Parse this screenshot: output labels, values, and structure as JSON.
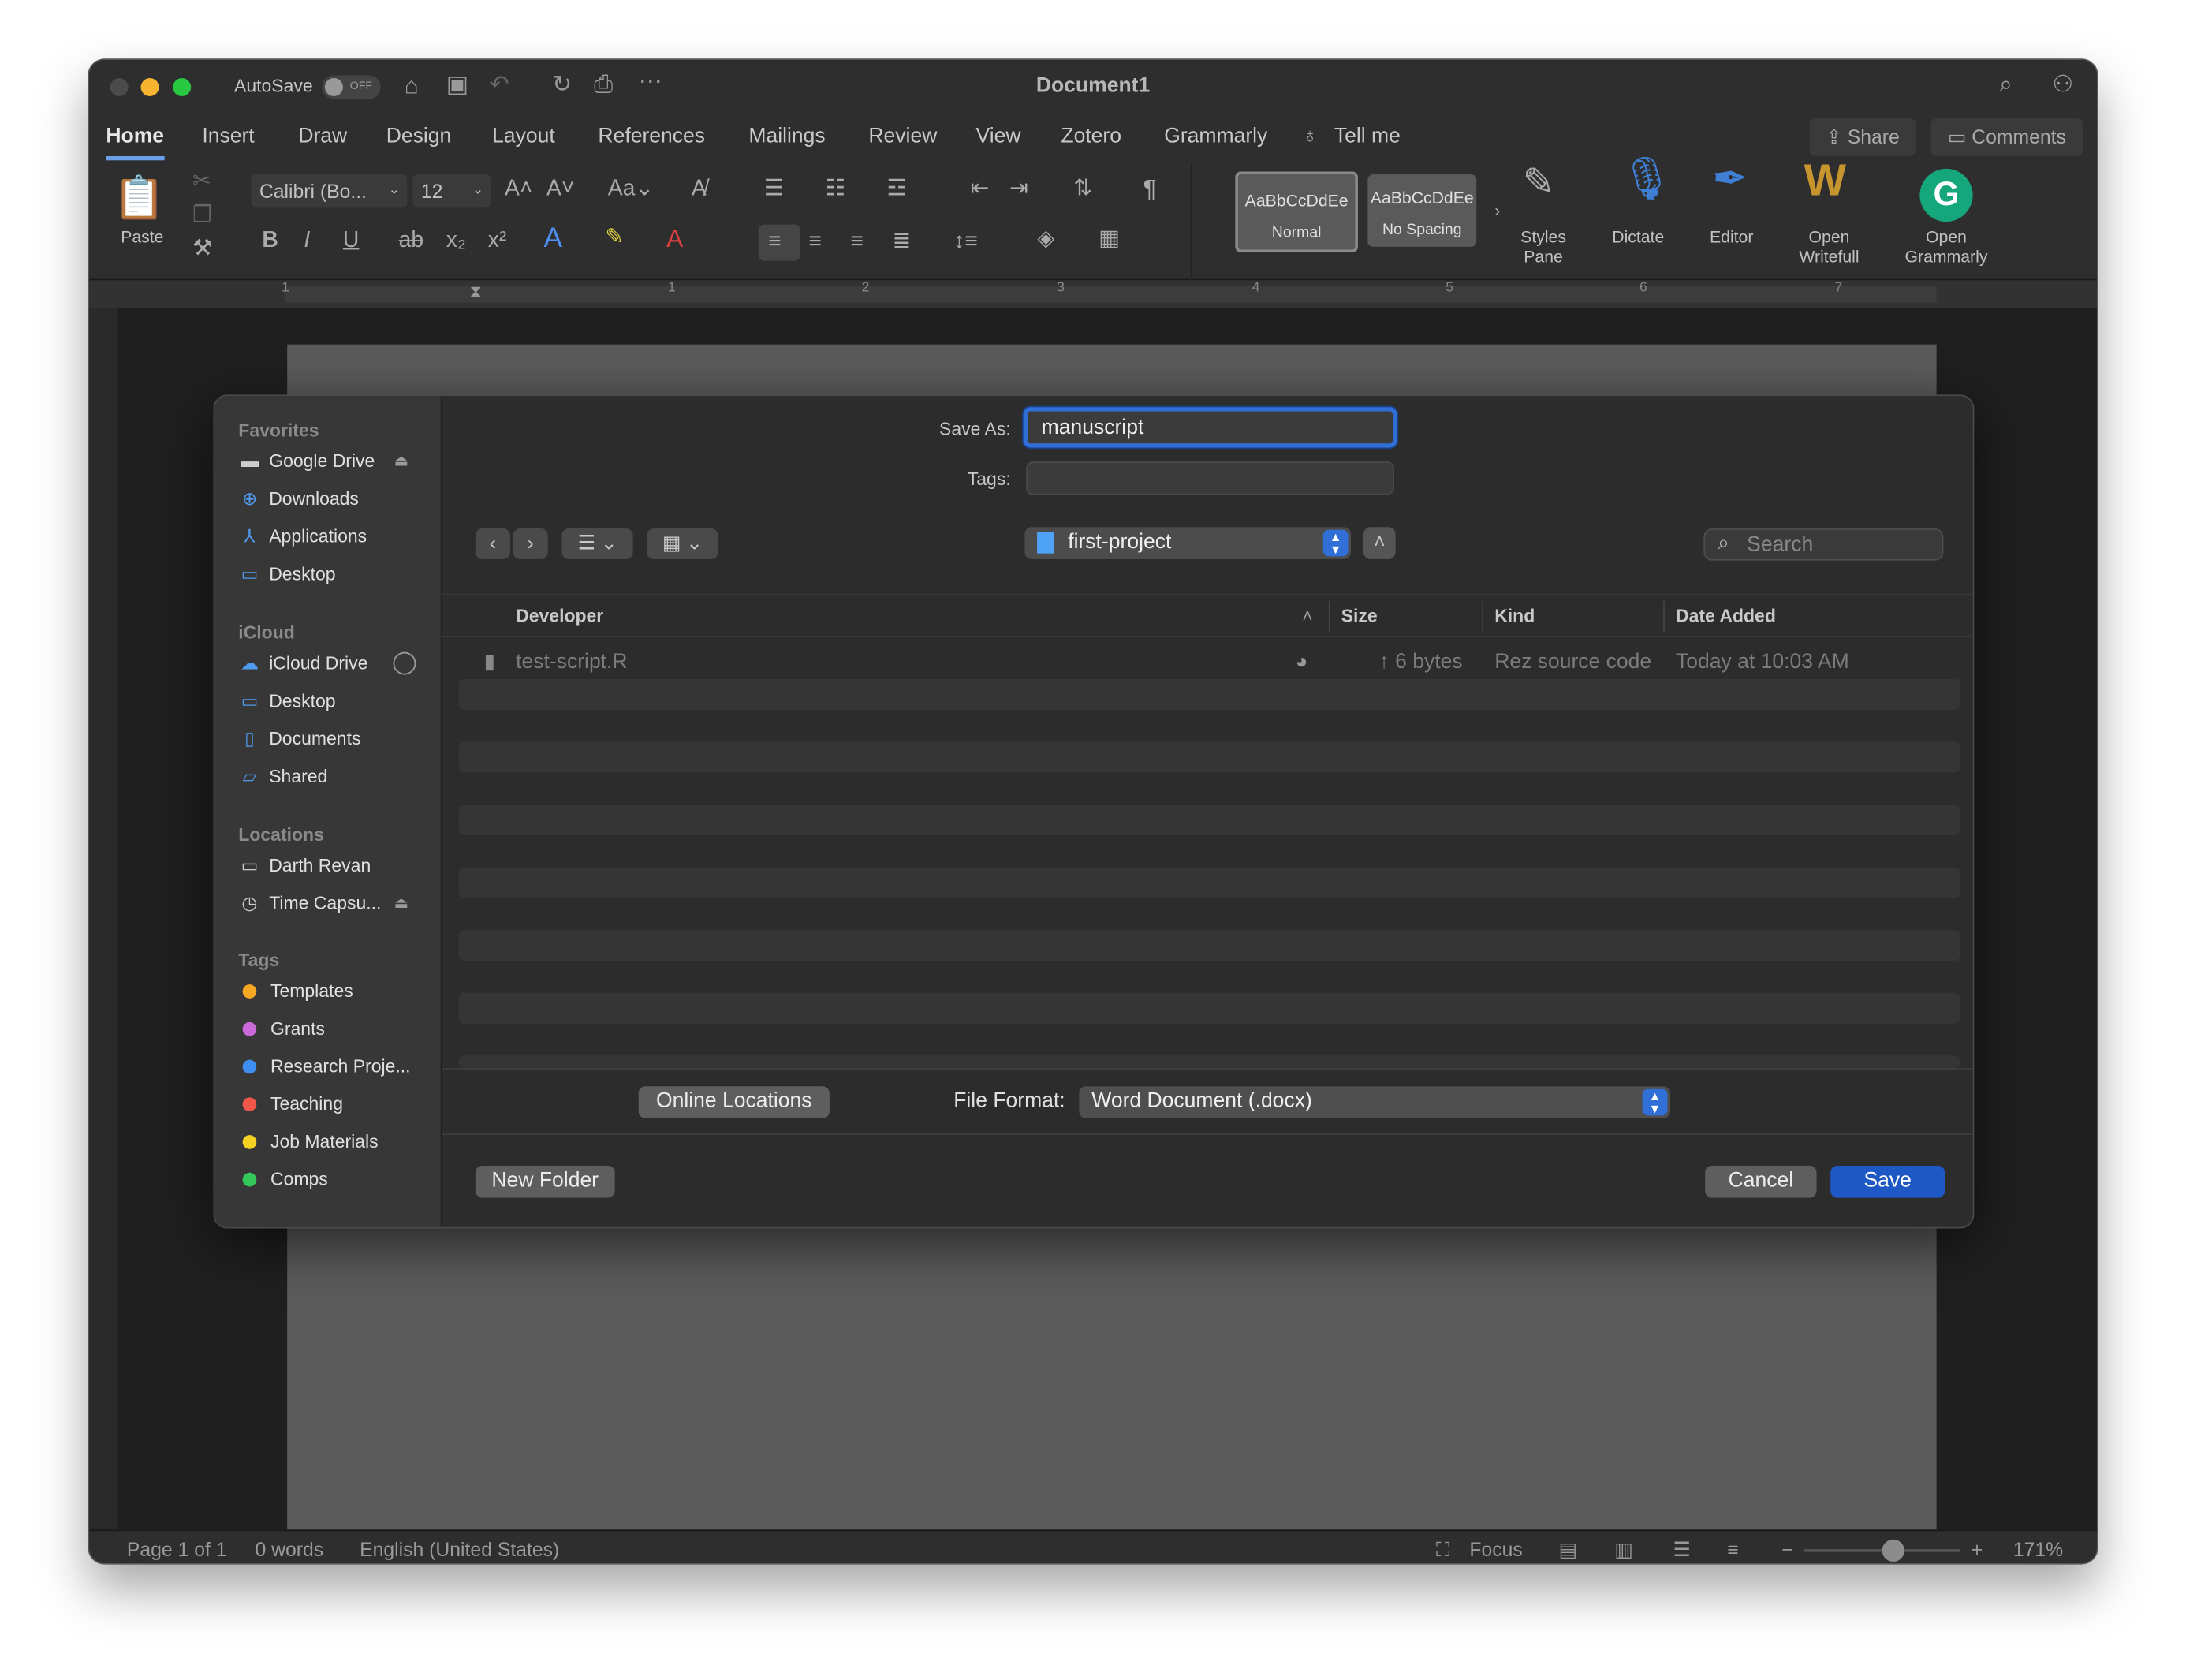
{
  "window": {
    "title": "Document1",
    "autosave_label": "AutoSave",
    "autosave_state": "OFF"
  },
  "ribbon_tabs": [
    "Home",
    "Insert",
    "Draw",
    "Design",
    "Layout",
    "References",
    "Mailings",
    "Review",
    "View",
    "Zotero",
    "Grammarly"
  ],
  "tell_me": "Tell me",
  "share_label": "Share",
  "comments_label": "Comments",
  "ribbon": {
    "paste_label": "Paste",
    "font_name": "Calibri (Bo...",
    "font_size": "12",
    "styles": [
      {
        "sample": "AaBbCcDdEe",
        "name": "Normal"
      },
      {
        "sample": "AaBbCcDdEe",
        "name": "No Spacing"
      }
    ],
    "styles_pane": [
      "Styles",
      "Pane"
    ],
    "dictate": "Dictate",
    "editor": "Editor",
    "writefull": [
      "Open",
      "Writefull"
    ],
    "grammarly": [
      "Open",
      "Grammarly"
    ]
  },
  "ruler_numbers": [
    "1",
    "1",
    "2",
    "3",
    "4",
    "5",
    "6",
    "7"
  ],
  "status": {
    "page": "Page 1 of 1",
    "words": "0 words",
    "language": "English (United States)",
    "focus": "Focus",
    "zoom": "171%"
  },
  "dialog": {
    "save_as_label": "Save As:",
    "save_as_value": "manuscript",
    "tags_label": "Tags:",
    "location": "first-project",
    "search_placeholder": "Search",
    "columns": {
      "name": "Developer",
      "size": "Size",
      "kind": "Kind",
      "date": "Date Added"
    },
    "files": [
      {
        "name": "test-script.R",
        "size": "↑ 6 bytes",
        "kind": "Rez source code",
        "date": "Today at 10:03 AM"
      }
    ],
    "online_locations": "Online Locations",
    "file_format_label": "File Format:",
    "file_format": "Word Document (.docx)",
    "new_folder": "New Folder",
    "cancel": "Cancel",
    "save": "Save"
  },
  "sidebar": {
    "favorites_heading": "Favorites",
    "favorites": [
      {
        "label": "Google Drive",
        "icon": "drive-folder-icon"
      },
      {
        "label": "Downloads",
        "icon": "downloads-icon"
      },
      {
        "label": "Applications",
        "icon": "applications-icon"
      },
      {
        "label": "Desktop",
        "icon": "desktop-icon"
      }
    ],
    "icloud_heading": "iCloud",
    "icloud": [
      {
        "label": "iCloud Drive",
        "icon": "cloud-icon"
      },
      {
        "label": "Desktop",
        "icon": "desktop-icon"
      },
      {
        "label": "Documents",
        "icon": "document-icon"
      },
      {
        "label": "Shared",
        "icon": "shared-folder-icon"
      }
    ],
    "locations_heading": "Locations",
    "locations": [
      {
        "label": "Darth Revan",
        "icon": "laptop-icon"
      },
      {
        "label": "Time Capsu...",
        "icon": "time-machine-icon"
      }
    ],
    "tags_heading": "Tags",
    "tags": [
      {
        "label": "Templates",
        "color": "#f5a623"
      },
      {
        "label": "Grants",
        "color": "#c96ad8"
      },
      {
        "label": "Research Proje...",
        "color": "#3d8ef0"
      },
      {
        "label": "Teaching",
        "color": "#f0564a"
      },
      {
        "label": "Job Materials",
        "color": "#f5d222"
      },
      {
        "label": "Comps",
        "color": "#34c759"
      }
    ]
  }
}
